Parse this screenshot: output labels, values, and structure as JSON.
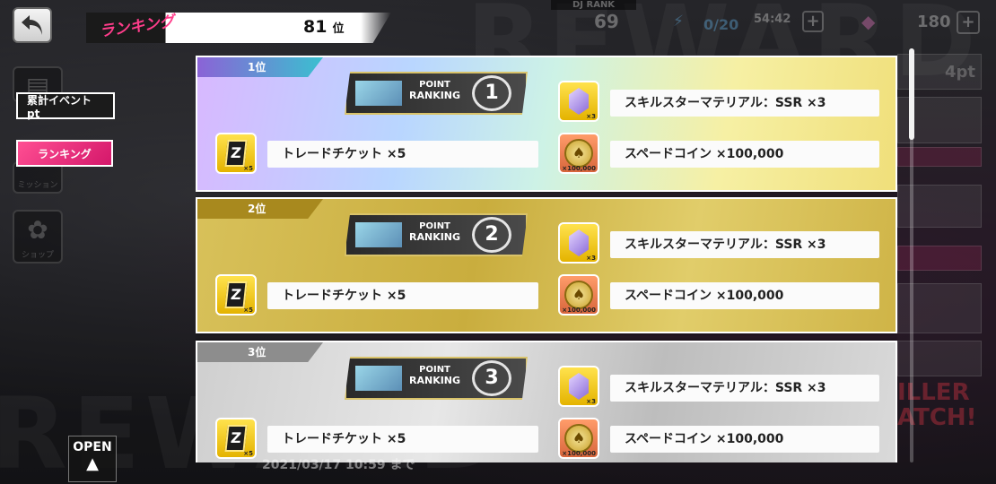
{
  "header": {
    "ranking_label": "ランキング",
    "rank_value": "81",
    "rank_unit": "位",
    "dj_rank_label": "DJ RANK",
    "dj_rank_value": "69",
    "energy": "0/20",
    "timer": "54:42",
    "gems": "180"
  },
  "menu": {
    "total_points": "累計イベントpt",
    "ranking": "ランキング",
    "mission": "ミッション",
    "shop": "ショップ"
  },
  "open_button": {
    "label": "OPEN"
  },
  "background": {
    "date": "2021/03/17 10:59 まで",
    "side_pt": "4pt",
    "side_killer": "ILLER ATCH!"
  },
  "ranking_badge": {
    "point": "POINT",
    "ranking": "RANKING"
  },
  "rewards": [
    {
      "rank_label": "1位",
      "rank_number": "1",
      "items": [
        {
          "icon": "material-icon",
          "qty": "×3",
          "text": "スキルスターマテリアル：SSR ×3"
        },
        {
          "icon": "ticket-icon",
          "qty": "×5",
          "text": "トレードチケット ×5"
        },
        {
          "icon": "coin-icon",
          "qty": "×100,000",
          "text": "スペードコイン ×100,000"
        }
      ]
    },
    {
      "rank_label": "2位",
      "rank_number": "2",
      "items": [
        {
          "icon": "material-icon",
          "qty": "×3",
          "text": "スキルスターマテリアル：SSR ×3"
        },
        {
          "icon": "ticket-icon",
          "qty": "×5",
          "text": "トレードチケット ×5"
        },
        {
          "icon": "coin-icon",
          "qty": "×100,000",
          "text": "スペードコイン ×100,000"
        }
      ]
    },
    {
      "rank_label": "3位",
      "rank_number": "3",
      "items": [
        {
          "icon": "material-icon",
          "qty": "×3",
          "text": "スキルスターマテリアル：SSR ×3"
        },
        {
          "icon": "ticket-icon",
          "qty": "×5",
          "text": "トレードチケット ×5"
        },
        {
          "icon": "coin-icon",
          "qty": "×100,000",
          "text": "スペードコイン ×100,000"
        }
      ]
    }
  ]
}
